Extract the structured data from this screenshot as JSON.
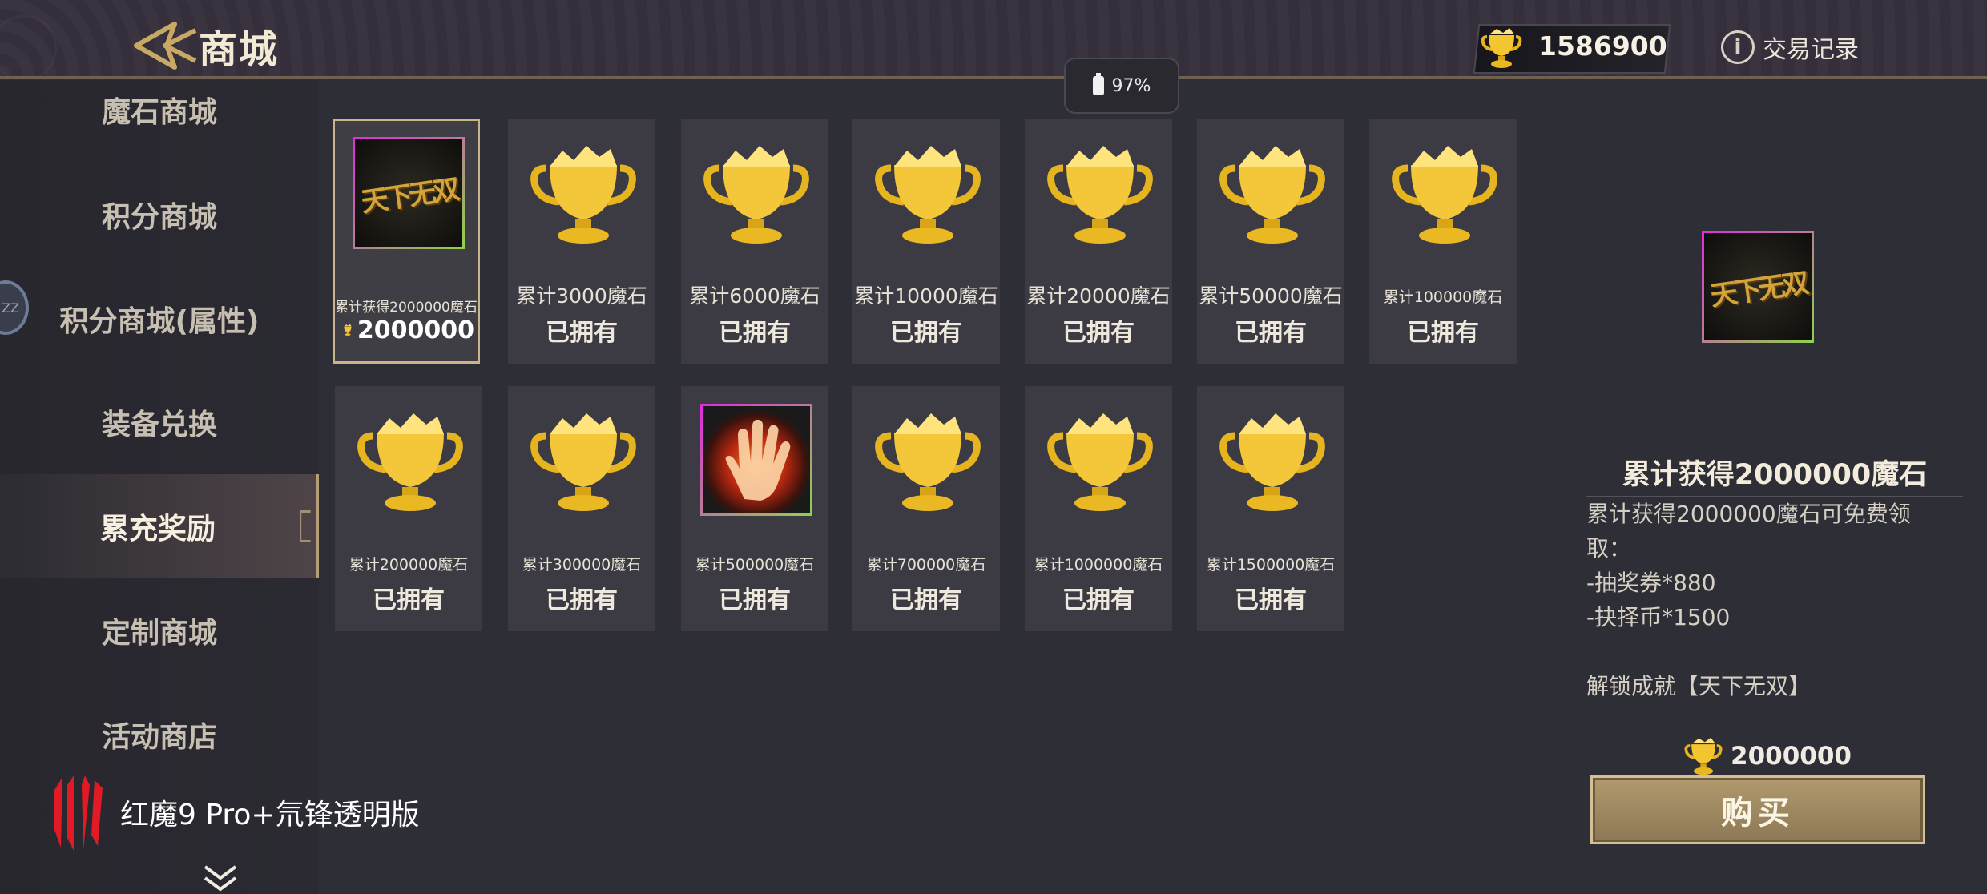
{
  "header": {
    "title": "商城",
    "currency_value": "1586900",
    "history_label": "交易记录",
    "battery": "97%"
  },
  "sidebar": {
    "items": [
      {
        "label": "魔石商城"
      },
      {
        "label": "积分商城"
      },
      {
        "label": "积分商城(属性)"
      },
      {
        "label": "装备兑换"
      },
      {
        "label": "累充奖励"
      },
      {
        "label": "定制商城"
      },
      {
        "label": "活动商店"
      }
    ],
    "active_index": 4,
    "brand_text": "红魔9 Pro+氘锋透明版",
    "zz_text": "ZZ"
  },
  "grid": {
    "items": [
      {
        "caption": "累计获得2000000魔石",
        "price": "2000000",
        "art": "tianxia-wushuang-title",
        "selected": true
      },
      {
        "caption": "累计3000魔石",
        "status": "已拥有",
        "art": "gold-trophy-icon"
      },
      {
        "caption": "累计6000魔石",
        "status": "已拥有",
        "art": "gold-trophy-icon"
      },
      {
        "caption": "累计10000魔石",
        "status": "已拥有",
        "art": "gold-trophy-icon"
      },
      {
        "caption": "累计20000魔石",
        "status": "已拥有",
        "art": "gold-trophy-icon"
      },
      {
        "caption": "累计50000魔石",
        "status": "已拥有",
        "art": "gold-trophy-icon"
      },
      {
        "caption": "累计100000魔石",
        "status": "已拥有",
        "art": "gold-trophy-icon"
      },
      {
        "caption": "累计200000魔石",
        "status": "已拥有",
        "art": "gold-trophy-icon"
      },
      {
        "caption": "累计300000魔石",
        "status": "已拥有",
        "art": "gold-trophy-icon"
      },
      {
        "caption": "累计500000魔石",
        "status": "已拥有",
        "art": "flame-hand-icon"
      },
      {
        "caption": "累计700000魔石",
        "status": "已拥有",
        "art": "gold-trophy-icon"
      },
      {
        "caption": "累计1000000魔石",
        "status": "已拥有",
        "art": "gold-trophy-icon"
      },
      {
        "caption": "累计1500000魔石",
        "status": "已拥有",
        "art": "gold-trophy-icon"
      }
    ]
  },
  "detail": {
    "logo_text": "天下无双",
    "title": "累计获得2000000魔石",
    "desc_lines": [
      "累计获得2000000魔石可免费领",
      "取：",
      "-抽奖券*880",
      "-抉择币*1500",
      "",
      "解锁成就【天下无双】"
    ],
    "price": "2000000",
    "buy_label": "购买"
  },
  "colors": {
    "accent_gold": "#c8b58a",
    "card_bg": "#3c3b43",
    "panel_bg": "#2e2e36"
  }
}
